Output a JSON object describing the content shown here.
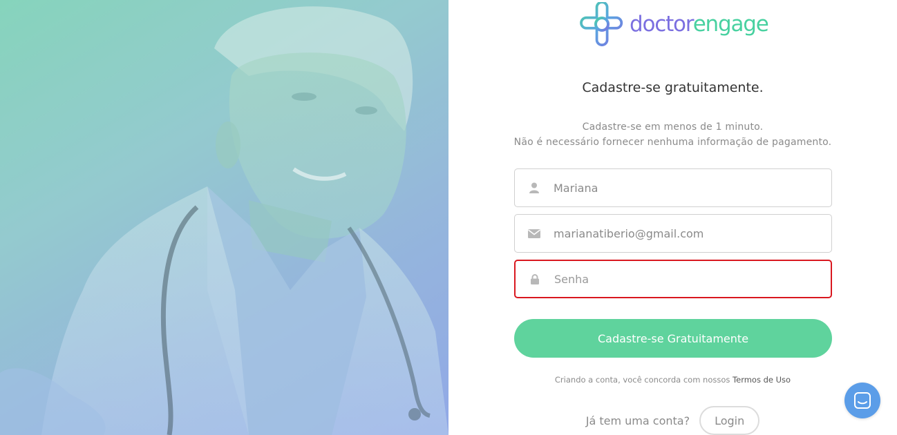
{
  "brand": {
    "name_part1": "doctor",
    "name_part2": "engage",
    "colors": {
      "purple": "#7b6fe0",
      "green": "#48d1a0",
      "accent_button": "#5fd39d",
      "error_border": "#d9171f",
      "chat_bubble": "#5b9de8"
    }
  },
  "form": {
    "title": "Cadastre-se gratuitamente.",
    "subtitle_line1": "Cadastre-se em menos de 1 minuto.",
    "subtitle_line2": "Não é necessário fornecer nenhuma informação de pagamento.",
    "name_field": {
      "icon": "user-icon",
      "value": "Mariana"
    },
    "email_field": {
      "icon": "envelope-icon",
      "value": "marianatiberio@gmail.com"
    },
    "password_field": {
      "icon": "lock-icon",
      "value": "",
      "placeholder": "Senha",
      "state": "error"
    },
    "submit_label": "Cadastre-se Gratuitamente",
    "terms_text": "Criando a conta, você concorda com nossos",
    "terms_link": "Termos de Uso",
    "login_question": "Já tem uma conta?",
    "login_label": "Login"
  },
  "hero": {
    "image": "doctor-photo"
  },
  "chat": {
    "icon": "chat-icon"
  }
}
